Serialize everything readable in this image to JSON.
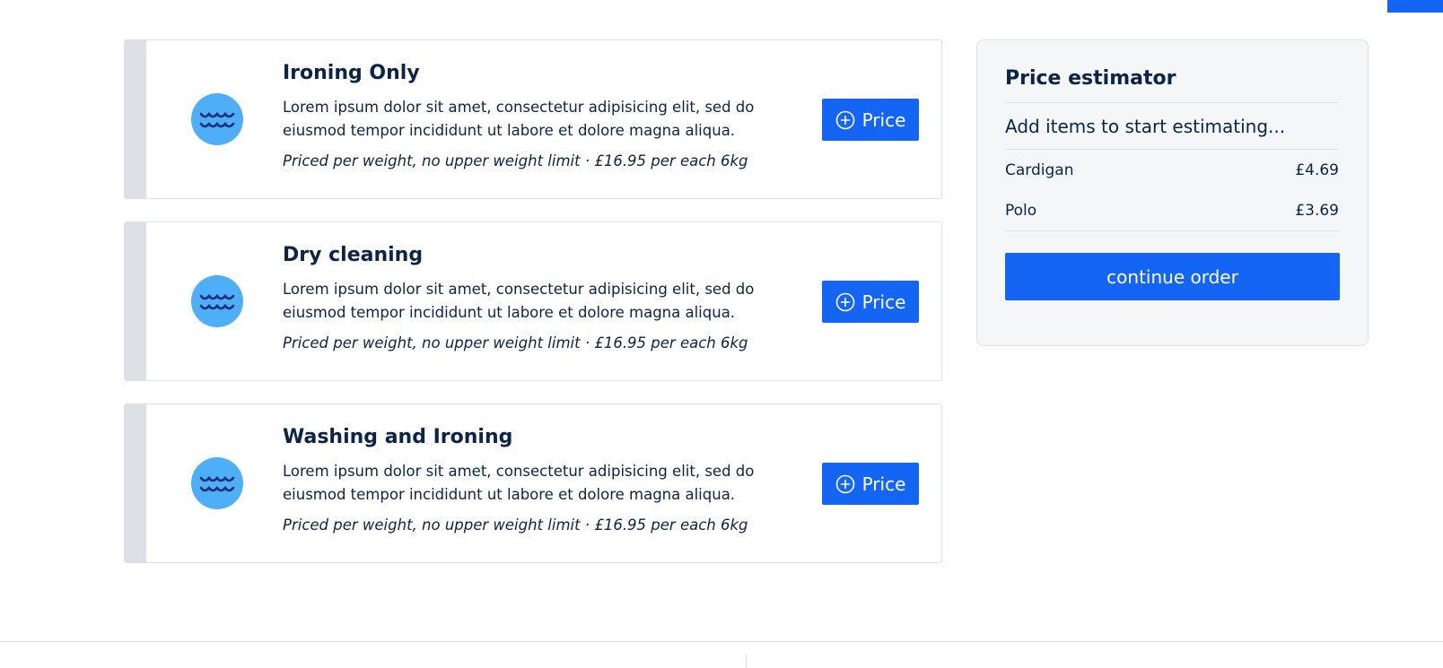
{
  "services": [
    {
      "title": "Ironing Only",
      "description": "Lorem ipsum dolor sit amet, consectetur adipisicing elit, sed do eiusmod tempor incididunt ut labore et dolore magna aliqua.",
      "pricing_note": "Priced per weight, no upper weight limit · £16.95 per each 6kg",
      "button_label": "Price",
      "icon": "water-waves-icon"
    },
    {
      "title": "Dry cleaning",
      "description": "Lorem ipsum dolor sit amet, consectetur adipisicing elit, sed do eiusmod tempor incididunt ut labore et dolore magna aliqua.",
      "pricing_note": "Priced per weight, no upper weight limit · £16.95 per each 6kg",
      "button_label": "Price",
      "icon": "water-waves-icon"
    },
    {
      "title": "Washing and Ironing",
      "description": "Lorem ipsum dolor sit amet, consectetur adipisicing elit, sed do eiusmod tempor incididunt ut labore et dolore magna aliqua.",
      "pricing_note": "Priced per weight, no upper weight limit · £16.95 per each 6kg",
      "button_label": "Price",
      "icon": "water-waves-icon"
    }
  ],
  "estimator": {
    "title": "Price estimator",
    "hint": "Add items to start estimating...",
    "items": [
      {
        "name": "Cardigan",
        "price": "£4.69"
      },
      {
        "name": "Polo",
        "price": "£3.69"
      }
    ],
    "continue_label": "continue order"
  },
  "colors": {
    "primary": "#1565f5",
    "text": "#0b2447",
    "icon_bg": "#4faef8",
    "icon_wave": "#1c2f7a",
    "stripe": "#dde1e6",
    "panel_bg": "#f4f6f8"
  }
}
